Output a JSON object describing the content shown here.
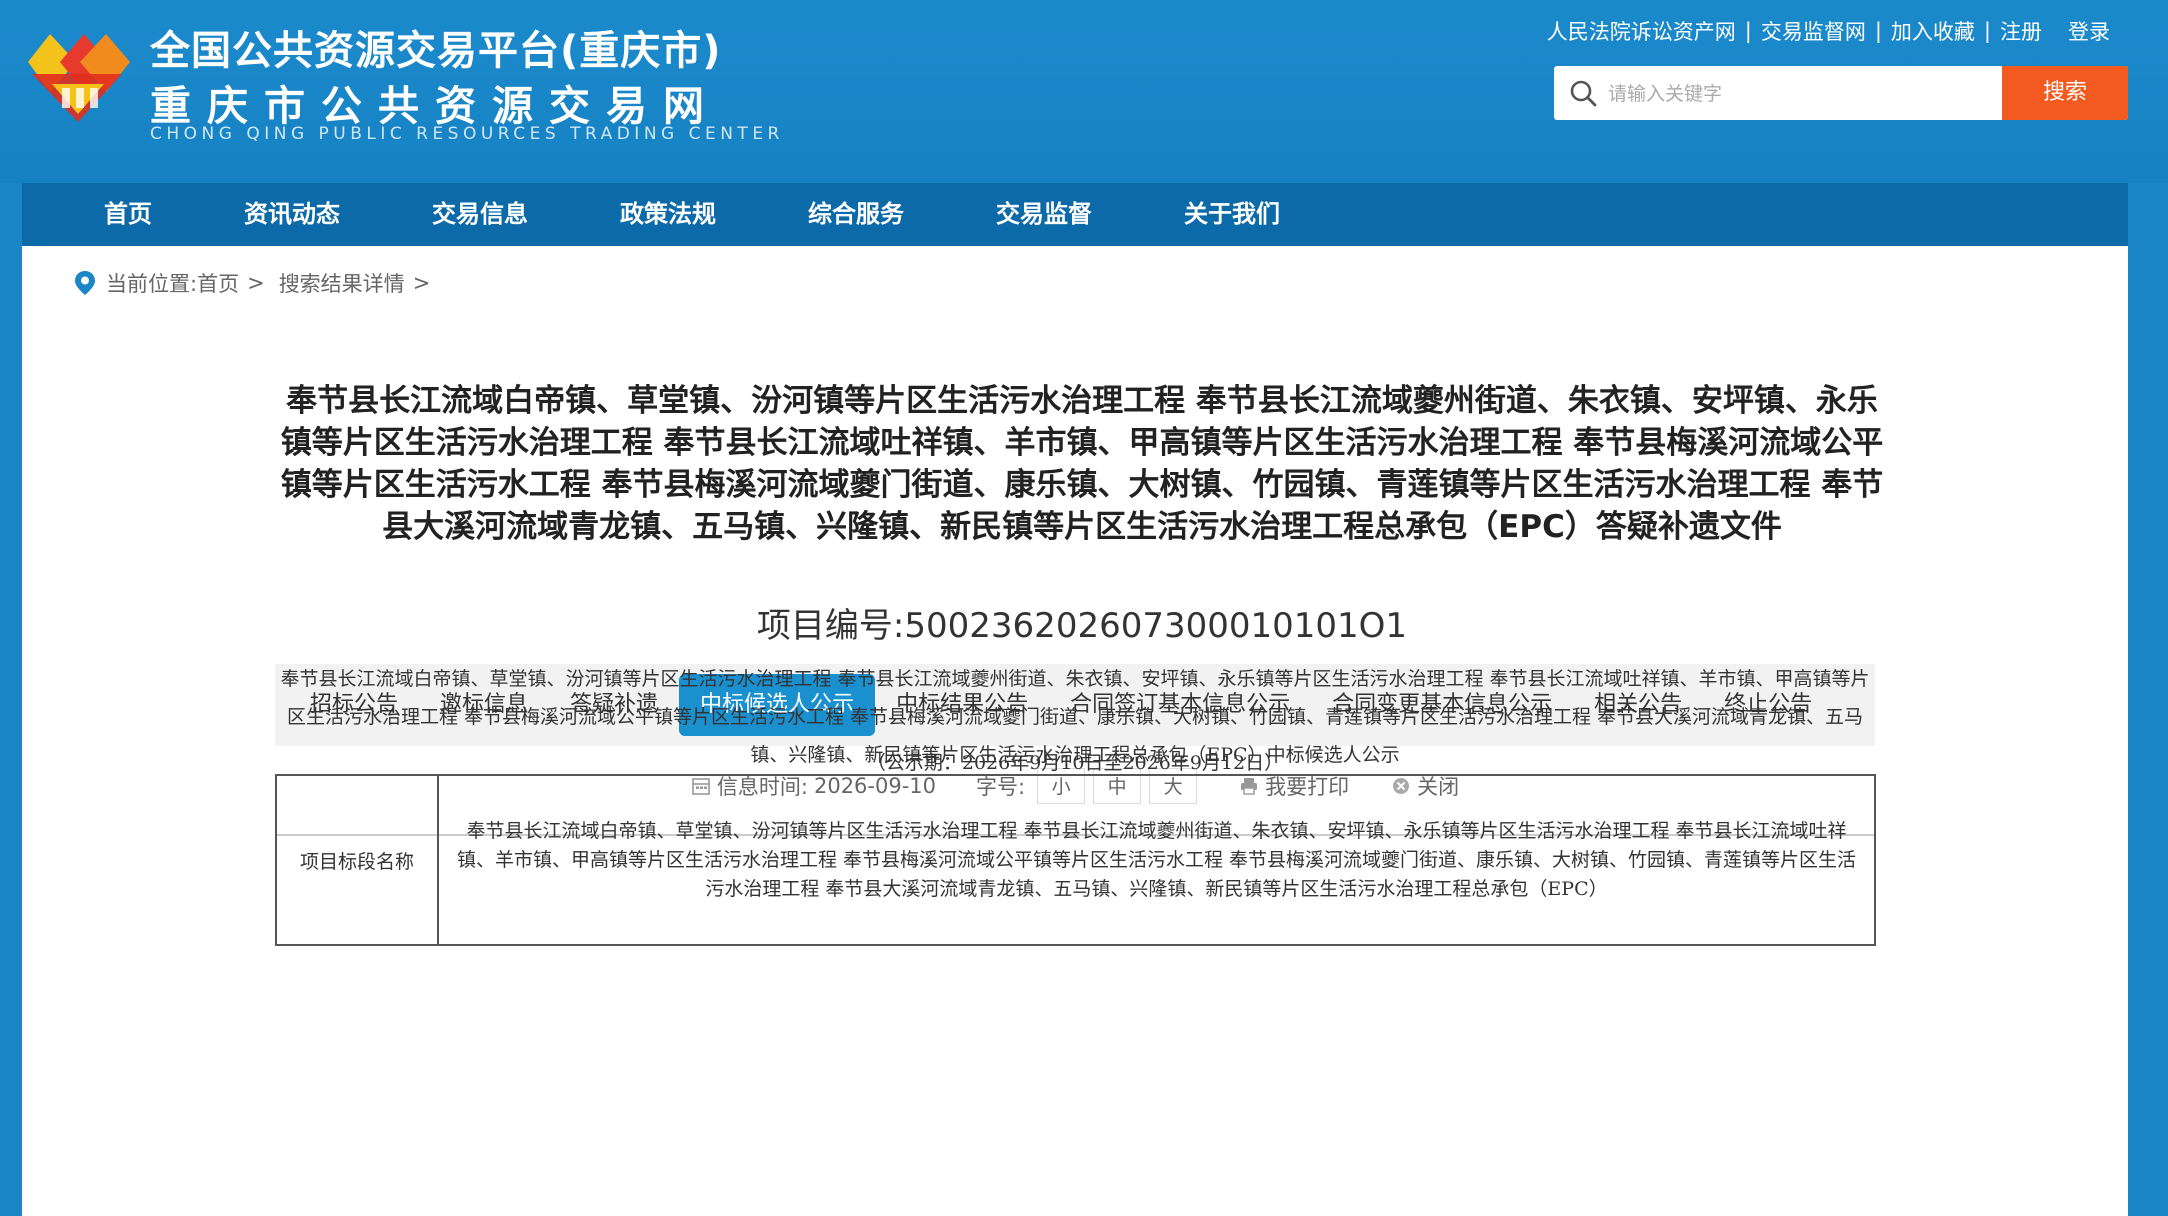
{
  "header": {
    "title_line1": "全国公共资源交易平台(重庆市)",
    "title_line2": "重庆市公共资源交易网",
    "title_line3": "CHONG QING PUBLIC RESOURCES TRADING CENTER",
    "logo_icon": "chongqing-resources-logo-icon",
    "links": [
      "人民法院诉讼资产网",
      "交易监督网",
      "加入收藏",
      "注册",
      "登录"
    ],
    "search": {
      "placeholder": "请输入关键字",
      "button": "搜索"
    }
  },
  "nav": [
    "首页",
    "资讯动态",
    "交易信息",
    "政策法规",
    "综合服务",
    "交易监督",
    "关于我们"
  ],
  "breadcrumb": {
    "prefix": "当前位置:",
    "items": [
      "首页",
      "搜索结果详情"
    ],
    "separator": ">"
  },
  "document": {
    "title": "奉节县长江流域白帝镇、草堂镇、汾河镇等片区生活污水治理工程 奉节县长江流域夔州街道、朱衣镇、安坪镇、永乐镇等片区生活污水治理工程 奉节县长江流域吐祥镇、羊市镇、甲高镇等片区生活污水治理工程 奉节县梅溪河流域公平镇等片区生活污水工程 奉节县梅溪河流域夔门街道、康乐镇、大树镇、竹园镇、青莲镇等片区生活污水治理工程 奉节县大溪河流域青龙镇、五马镇、兴隆镇、新民镇等片区生活污水治理工程总承包（EPC）答疑补遗文件",
    "project_no_label": "项目编号:",
    "project_no": "500236202607300010101O1"
  },
  "tabs": {
    "items": [
      "招标公告",
      "邀标信息",
      "答疑补遗",
      "中标候选人公示",
      "中标结果公告",
      "合同签订基本信息公示",
      "合同变更基本信息公示",
      "相关公告",
      "终止公告"
    ],
    "active_index": 3
  },
  "meta": {
    "time_label": "信息时间:",
    "time_value": "2026-09-10",
    "font_label": "字号:",
    "font_sizes": [
      "小",
      "中",
      "大"
    ],
    "print": "我要打印",
    "close": "关闭"
  },
  "content": {
    "heading": "奉节县长江流域白帝镇、草堂镇、汾河镇等片区生活污水治理工程 奉节县长江流域夔州街道、朱衣镇、安坪镇、永乐镇等片区生活污水治理工程 奉节县长江流域吐祥镇、羊市镇、甲高镇等片区生活污水治理工程 奉节县梅溪河流域公平镇等片区生活污水工程 奉节县梅溪河流域夔门街道、康乐镇、大树镇、竹园镇、青莲镇等片区生活污水治理工程 奉节县大溪河流域青龙镇、五马镇、兴隆镇、新民镇等片区生活污水治理工程总承包（EPC）中标候选人公示",
    "period": "（公示期：2026年9月10日至2026年9月12日）",
    "table": [
      {
        "key": "项目标段名称",
        "value": "奉节县长江流域白帝镇、草堂镇、汾河镇等片区生活污水治理工程 奉节县长江流域夔州街道、朱衣镇、安坪镇、永乐镇等片区生活污水治理工程 奉节县长江流域吐祥镇、羊市镇、甲高镇等片区生活污水治理工程 奉节县梅溪河流域公平镇等片区生活污水工程 奉节县梅溪河流域夔门街道、康乐镇、大树镇、竹园镇、青莲镇等片区生活污水治理工程 奉节县大溪河流域青龙镇、五马镇、兴隆镇、新民镇等片区生活污水治理工程总承包（EPC）"
      }
    ]
  },
  "colors": {
    "header_bg": "#1a86c7",
    "nav_bg": "#0c6aa8",
    "search_button": "#f25a1f",
    "active_tab": "#1a90cf"
  }
}
